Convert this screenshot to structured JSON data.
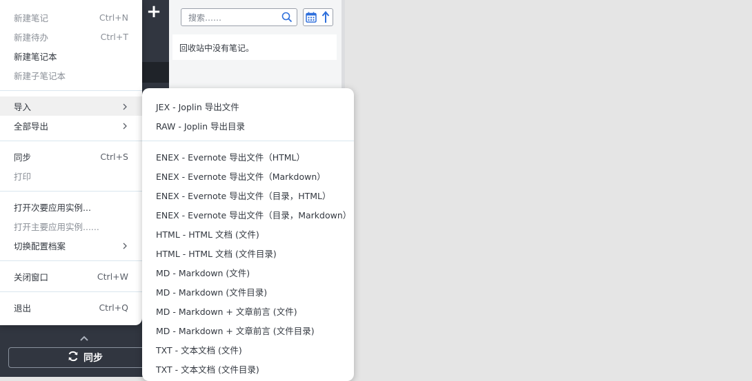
{
  "search": {
    "placeholder": "搜索……"
  },
  "note_list": {
    "empty_message": "回收站中没有笔记。"
  },
  "sidebar": {
    "sync_label": "同步"
  },
  "file_menu": {
    "items": [
      {
        "label": "新建笔记",
        "accelerator": "Ctrl+N",
        "disabled": true
      },
      {
        "label": "新建待办",
        "accelerator": "Ctrl+T",
        "disabled": true
      },
      {
        "label": "新建笔记本",
        "accelerator": "",
        "disabled": false
      },
      {
        "label": "新建子笔记本",
        "accelerator": "",
        "disabled": true
      },
      {
        "label": "导入",
        "submenu": true,
        "highlighted": true
      },
      {
        "label": "全部导出",
        "submenu": true
      },
      {
        "label": "同步",
        "accelerator": "Ctrl+S"
      },
      {
        "label": "打印",
        "disabled": true
      },
      {
        "label": "打开次要应用实例..."
      },
      {
        "label": "打开主要应用实例......",
        "disabled": true
      },
      {
        "label": "切换配置档案",
        "submenu": true
      },
      {
        "label": "关闭窗口",
        "accelerator": "Ctrl+W"
      },
      {
        "label": "退出",
        "accelerator": "Ctrl+Q"
      }
    ]
  },
  "import_submenu": {
    "items": [
      "JEX - Joplin 导出文件",
      "RAW - Joplin 导出目录",
      "ENEX - Evernote 导出文件（HTML）",
      "ENEX - Evernote 导出文件（Markdown）",
      "ENEX - Evernote 导出文件（目录，HTML）",
      "ENEX - Evernote 导出文件（目录，Markdown）",
      "HTML - HTML 文档 (文件)",
      "HTML - HTML 文档 (文件目录)",
      "MD - Markdown (文件)",
      "MD - Markdown (文件目录)",
      "MD - Markdown + 文章前言 (文件)",
      "MD - Markdown + 文章前言 (文件目录)",
      "TXT - 文本文档 (文件)",
      "TXT - 文本文档 (文件目录)"
    ]
  },
  "colors": {
    "accent": "#2e6fdb",
    "sidebar_bg": "#313640"
  }
}
